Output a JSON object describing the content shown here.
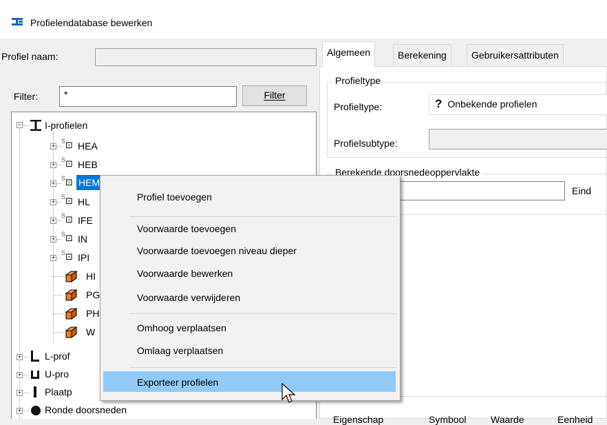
{
  "window": {
    "title": "Profielendatabase bewerken"
  },
  "left": {
    "profile_name_label": "Profiel naam:",
    "profile_name_value": "",
    "filter_label": "Filter:",
    "filter_value": "*",
    "filter_button": "Filter"
  },
  "tree": {
    "root": "I-profielen",
    "children": [
      "HEA",
      "HEB",
      "HEM",
      "HL",
      "IFE",
      "IN",
      "IPI",
      "HI",
      "PG",
      "PH",
      "W"
    ],
    "siblings": [
      "L-prof",
      "U-pro",
      "Plaatp",
      "Ronde doorsneden"
    ]
  },
  "tabs": [
    "Algemeen",
    "Berekening",
    "Gebruikersattributen"
  ],
  "general": {
    "profiletype_group": "Profieltype",
    "profiletype_label": "Profieltype:",
    "profiletype_value": "Onbekende profielen",
    "profiletype_icon": "?",
    "subtype_label": "Profielsubtype:",
    "area_group": "Berekende doorsnedeoppervlakte",
    "unit_label": "Eind"
  },
  "table": {
    "columns": [
      "Eigenschap",
      "Symbool",
      "Waarde",
      "Eenheid"
    ]
  },
  "context_menu": {
    "items": [
      "Profiel toevoegen",
      "Voorwaarde toevoegen",
      "Voorwaarde toevoegen niveau dieper",
      "Voorwaarde bewerken",
      "Voorwaarde verwijderen",
      "Omhoog verplaatsen",
      "Omlaag verplaatsen",
      "Exporteer profielen"
    ],
    "highlighted_index": 7
  },
  "colors": {
    "selection": "#0078d7",
    "menu_hover": "#91c9f7",
    "cube_orange": "#f07a1a"
  }
}
